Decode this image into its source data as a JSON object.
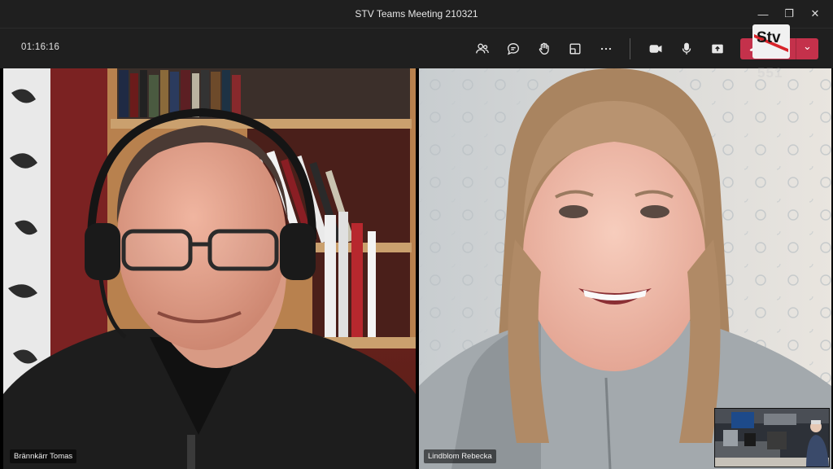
{
  "window": {
    "title": "STV Teams Meeting 210321",
    "minimize_glyph": "—",
    "restore_glyph": "❐",
    "close_glyph": "✕"
  },
  "toolbar": {
    "timer": "01:16:16",
    "icons": [
      "people-icon",
      "chat-icon",
      "raise-hand-icon",
      "rooms-icon",
      "more-icon",
      "camera-icon",
      "mic-icon",
      "share-icon"
    ],
    "leave_chevron": "⌄"
  },
  "logo": {
    "text": "Stv",
    "channel": "551"
  },
  "participants": [
    {
      "name": "Brännkärr Tomas"
    },
    {
      "name": "Lindblom Rebecka"
    }
  ],
  "colors": {
    "bar": "#1f1f1f",
    "leave": "#c4314b",
    "logo_red": "#d8242a"
  }
}
